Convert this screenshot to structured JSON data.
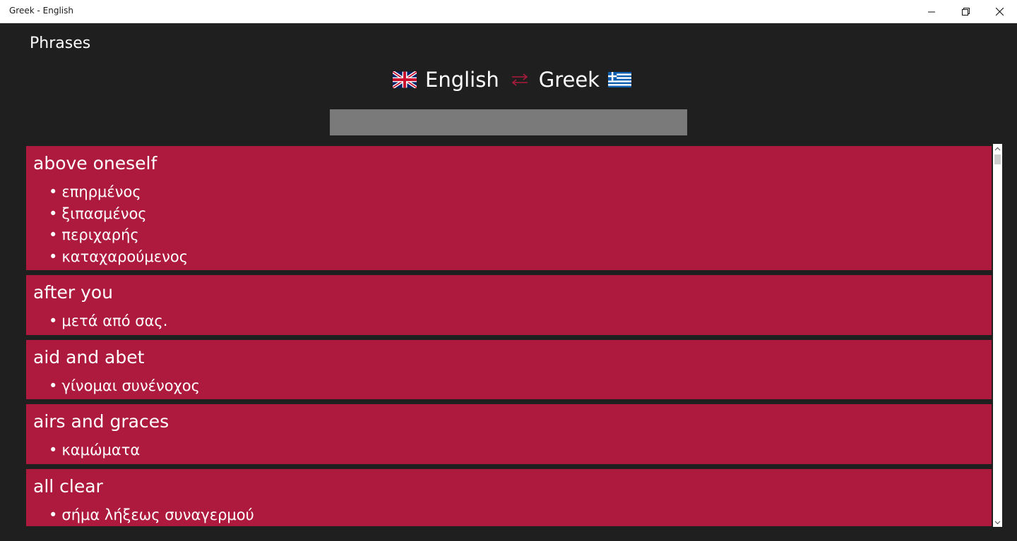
{
  "window": {
    "title": "Greek - English",
    "controls": [
      "minimize-icon",
      "restore-icon",
      "close-icon"
    ]
  },
  "page": {
    "heading": "Phrases"
  },
  "language_bar": {
    "from_label": "English",
    "from_flag": "uk-flag-icon",
    "swap_icon": "swap-arrows-icon",
    "to_label": "Greek",
    "to_flag": "greek-flag-icon",
    "accent_color": "#ad1a3d"
  },
  "search": {
    "value": "",
    "placeholder": ""
  },
  "phrases": [
    {
      "term": "above oneself",
      "translations": [
        "επηρμένος",
        "ξιπασμένος",
        "περιχαρής",
        "καταχαρούμενος"
      ]
    },
    {
      "term": "after you",
      "translations": [
        "μετά από σας."
      ]
    },
    {
      "term": "aid and abet",
      "translations": [
        "γίνομαι συνένοχος"
      ]
    },
    {
      "term": "airs and graces",
      "translations": [
        "καμώματα"
      ]
    },
    {
      "term": "all clear",
      "translations": [
        "σήμα λήξεως συναγερμού"
      ]
    }
  ],
  "colors": {
    "background": "#1f1f1f",
    "card": "#ad1a3d",
    "search_box": "#7a7a7a"
  }
}
